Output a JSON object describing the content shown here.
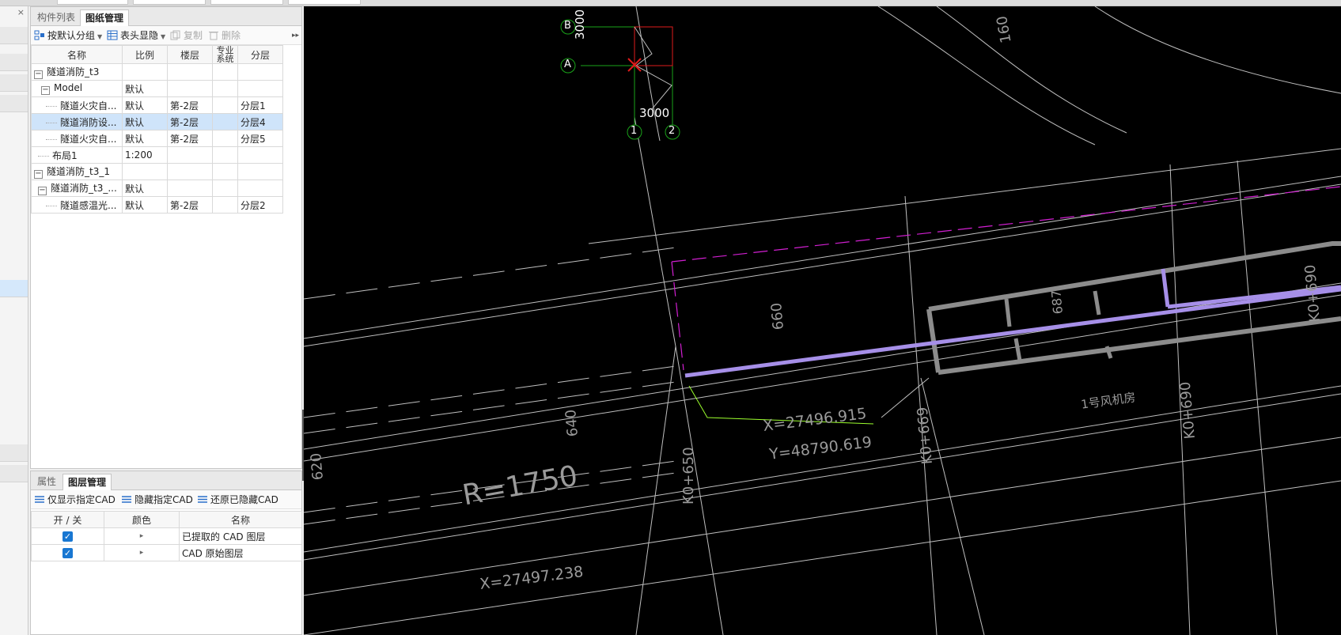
{
  "top_panel": {
    "tabs": [
      "构件列表",
      "图纸管理"
    ],
    "close_symbol": "×",
    "toolbar": {
      "group": "按默认分组",
      "header_toggle": "表头显隐",
      "copy": "复制",
      "delete": "删除",
      "more": "▸▸"
    },
    "columns": [
      "名称",
      "比例",
      "楼层",
      "专业系统",
      "分层"
    ],
    "rows": [
      {
        "name": "隧道消防_t3",
        "scale": "",
        "floor": "",
        "system": "",
        "layer": ""
      },
      {
        "name": "Model",
        "scale": "默认",
        "floor": "",
        "system": "",
        "layer": ""
      },
      {
        "name": "隧道火灾自...",
        "scale": "默认",
        "floor": "第-2层",
        "system": "",
        "layer": "分层1"
      },
      {
        "name": "隧道消防设...",
        "scale": "默认",
        "floor": "第-2层",
        "system": "",
        "layer": "分层4"
      },
      {
        "name": "隧道火灾自...",
        "scale": "默认",
        "floor": "第-2层",
        "system": "",
        "layer": "分层5"
      },
      {
        "name": "布局1",
        "scale": "1:200",
        "floor": "",
        "system": "",
        "layer": ""
      },
      {
        "name": "隧道消防_t3_1",
        "scale": "",
        "floor": "",
        "system": "",
        "layer": ""
      },
      {
        "name": "隧道消防_t3_...",
        "scale": "默认",
        "floor": "",
        "system": "",
        "layer": ""
      },
      {
        "name": "隧道感温光...",
        "scale": "默认",
        "floor": "第-2层",
        "system": "",
        "layer": "分层2"
      }
    ]
  },
  "bottom_panel": {
    "tabs": [
      "属性",
      "图层管理"
    ],
    "toolbar": {
      "show_only": "仅显示指定CAD",
      "hide": "隐藏指定CAD",
      "restore": "还原已隐藏CAD"
    },
    "columns": [
      "开 / 关",
      "颜色",
      "名称"
    ],
    "layers": [
      {
        "on": true,
        "color_symbol": "▸",
        "name": "已提取的 CAD 图层"
      },
      {
        "on": true,
        "color_symbol": "▸",
        "name": "CAD 原始图层"
      }
    ]
  },
  "cad": {
    "axis": {
      "row_a": "A",
      "row_b": "B",
      "col_1": "1",
      "col_2": "2",
      "dim_v": "3000",
      "dim_h": "3000"
    },
    "labels": {
      "radius": "R=1750",
      "x_coord_1": "X=27496.915",
      "y_coord": "Y=48790.619",
      "x_coord_2": "X=27497.238",
      "k650": "K0+650",
      "k669": "K0+669",
      "k690a": "K0+690",
      "k690b": "K0+690",
      "s660": "660",
      "s640": "640",
      "s620": "620",
      "s160": "160",
      "s687": "687",
      "fan_room": "1号风机房"
    },
    "colors": {
      "background": "#000000",
      "line": "#bfbfbf",
      "pipe": "#a68fe8",
      "dash": "#d21fd2",
      "axis_circle": "#1aa31a",
      "marker": "#e01b1b",
      "note": "#9cff2e"
    }
  }
}
